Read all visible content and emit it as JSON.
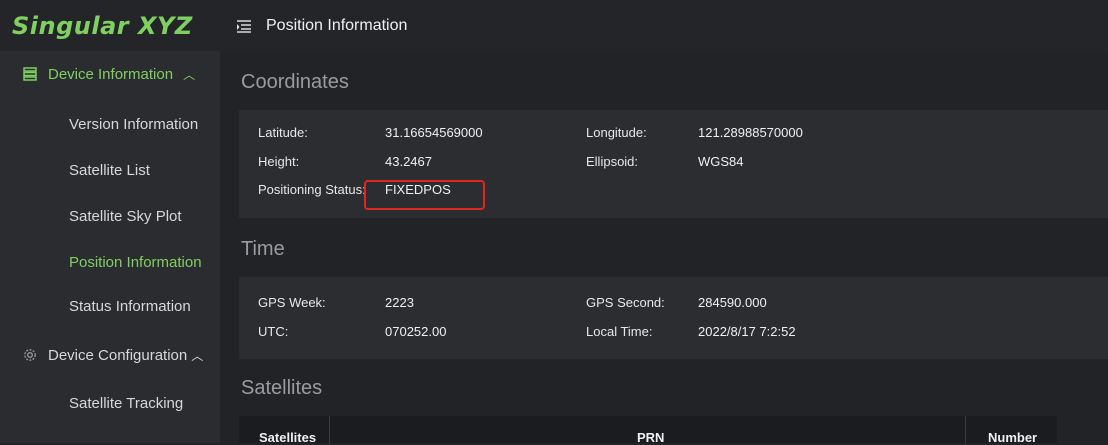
{
  "brand": {
    "logo_text": "Singular XYZ",
    "accent": "#7fd061",
    "highlight_border": "#e0261e"
  },
  "header": {
    "title": "Position Information"
  },
  "sidebar": {
    "groups": [
      {
        "label": "Device Information",
        "icon": "server-icon",
        "expanded": true,
        "items": [
          "Version Information",
          "Satellite List",
          "Satellite Sky Plot",
          "Position Information",
          "Status Information"
        ]
      },
      {
        "label": "Device Configuration",
        "icon": "gear-icon",
        "expanded": true,
        "items": [
          "Satellite Tracking"
        ]
      }
    ],
    "active_item": "Position Information"
  },
  "coordinates": {
    "title": "Coordinates",
    "latitude_label": "Latitude:",
    "latitude": "31.16654569000",
    "longitude_label": "Longitude:",
    "longitude": "121.28988570000",
    "height_label": "Height:",
    "height": "43.2467",
    "ellipsoid_label": "Ellipsoid:",
    "ellipsoid": "WGS84",
    "status_label": "Positioning Status:",
    "status": "FIXEDPOS"
  },
  "time": {
    "title": "Time",
    "gps_week_label": "GPS Week:",
    "gps_week": "2223",
    "gps_second_label": "GPS Second:",
    "gps_second": "284590.000",
    "utc_label": "UTC:",
    "utc": "070252.00",
    "local_time_label": "Local Time:",
    "local_time": "2022/8/17 7:2:52"
  },
  "satellites": {
    "title": "Satellites",
    "columns": [
      "Satellites",
      "PRN",
      "Number"
    ]
  }
}
